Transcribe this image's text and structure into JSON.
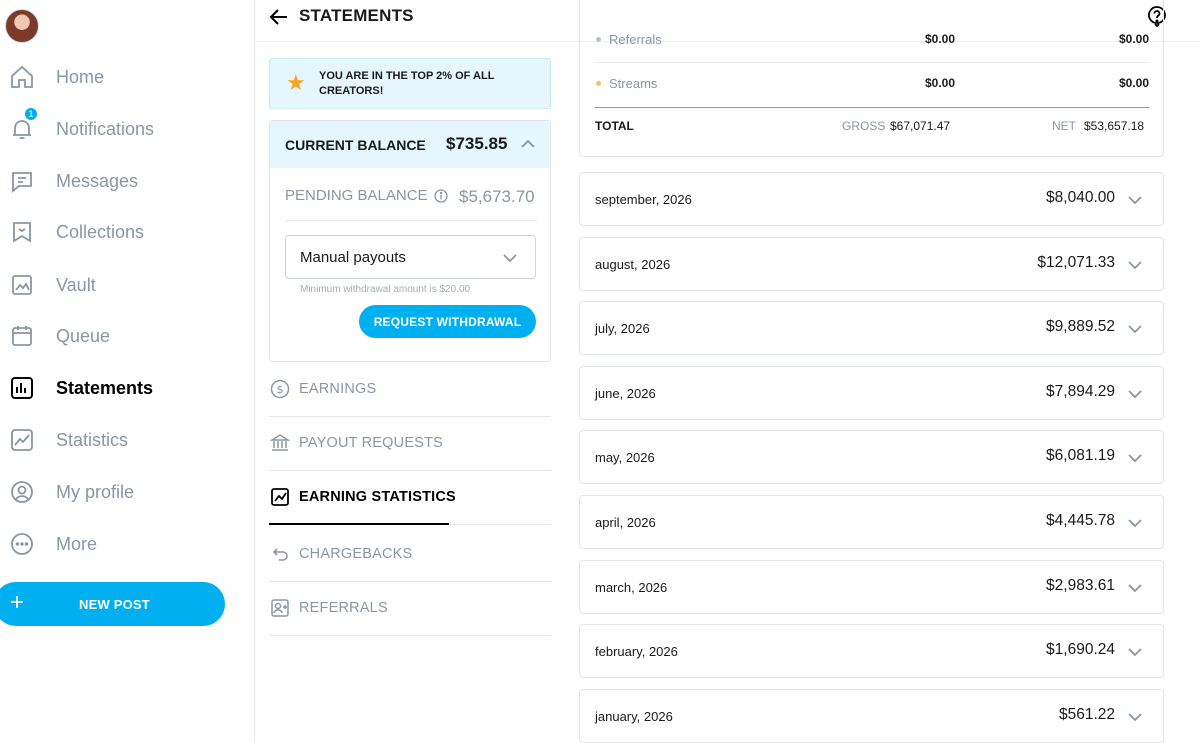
{
  "sidebar": {
    "items": [
      {
        "label": "Home"
      },
      {
        "label": "Notifications",
        "badge": "1"
      },
      {
        "label": "Messages"
      },
      {
        "label": "Collections"
      },
      {
        "label": "Vault"
      },
      {
        "label": "Queue"
      },
      {
        "label": "Statements"
      },
      {
        "label": "Statistics"
      },
      {
        "label": "My profile"
      },
      {
        "label": "More"
      }
    ],
    "new_post_label": "NEW POST"
  },
  "header": {
    "title": "STATEMENTS"
  },
  "banner": {
    "text": "YOU ARE IN THE TOP 2% OF ALL CREATORS!"
  },
  "balance": {
    "current_label": "CURRENT BALANCE",
    "current_value": "$735.85",
    "pending_label": "PENDING BALANCE",
    "pending_value": "$5,673.70",
    "payout_mode": "Manual payouts",
    "min_note": "Minimum withdrawal amount is $20.00",
    "request_label": "REQUEST WITHDRAWAL"
  },
  "menu": [
    {
      "label": "EARNINGS"
    },
    {
      "label": "PAYOUT REQUESTS"
    },
    {
      "label": "EARNING STATISTICS"
    },
    {
      "label": "CHARGEBACKS"
    },
    {
      "label": "REFERRALS"
    }
  ],
  "summary": {
    "rows": [
      {
        "name": "Referrals",
        "gross": "$0.00",
        "net": "$0.00",
        "dot_color": "#b9c3cc"
      },
      {
        "name": "Streams",
        "gross": "$0.00",
        "net": "$0.00",
        "dot_color": "#f5c26b"
      }
    ],
    "total_label": "TOTAL",
    "gross_label": "GROSS",
    "gross_value": "$67,071.47",
    "net_label": "NET",
    "net_value": "$53,657.18"
  },
  "months": [
    {
      "month": "september, 2026",
      "amount": "$8,040.00"
    },
    {
      "month": "august, 2026",
      "amount": "$12,071.33"
    },
    {
      "month": "july, 2026",
      "amount": "$9,889.52"
    },
    {
      "month": "june, 2026",
      "amount": "$7,894.29"
    },
    {
      "month": "may, 2026",
      "amount": "$6,081.19"
    },
    {
      "month": "april, 2026",
      "amount": "$4,445.78"
    },
    {
      "month": "march, 2026",
      "amount": "$2,983.61"
    },
    {
      "month": "february, 2026",
      "amount": "$1,690.24"
    },
    {
      "month": "january, 2026",
      "amount": "$561.22"
    }
  ],
  "colors": {
    "accent": "#00aff0",
    "muted": "#8a96a3",
    "banner_bg": "#e5f6fd"
  }
}
